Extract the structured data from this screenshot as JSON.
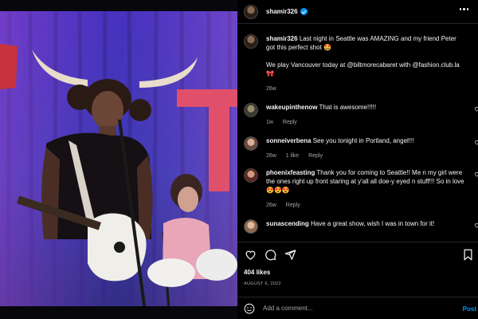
{
  "post": {
    "username": "shamir326",
    "caption_line1": "Last night in Seattle was AMAZING and my friend Peter got this perfect shot 🤩",
    "caption_line2": "We play Vancouver today at @biltmorecabaret with @fashion.club.la 🎀",
    "caption_time": "26w",
    "likes": "404 likes",
    "date": "AUGUST 6, 2022",
    "add_comment_placeholder": "Add a comment...",
    "post_label": "Post"
  },
  "comments": [
    {
      "username": "wakeupinthenow",
      "text": "That is awesome!!!!!",
      "time": "1w",
      "likes": "",
      "reply": "Reply"
    },
    {
      "username": "sonneiverbena",
      "text": "See you tonight in Portland, angel!!!",
      "time": "26w",
      "likes": "1 like",
      "reply": "Reply"
    },
    {
      "username": "phoenixfeasting",
      "text": "Thank you for coming to Seattle!! Me n my girl were the ones right up front staring at y'all all doe-y eyed n stuff!!! So in love 😍😍😍",
      "time": "26w",
      "likes": "",
      "reply": "Reply"
    },
    {
      "username": "sunascending",
      "text": "Have a great show, wish I was in town for it!",
      "time": "",
      "likes": "",
      "reply": ""
    }
  ],
  "icons": {
    "verified": "verified-badge-icon",
    "more": "more-options-icon",
    "like": "heart-icon",
    "comment": "comment-icon",
    "share": "share-icon",
    "save": "bookmark-icon",
    "emoji": "emoji-icon"
  },
  "colors": {
    "background": "#000000",
    "text": "#f5f5f5",
    "secondary_text": "#a8a8a8",
    "link_blue": "#0095f6",
    "divider": "#262626"
  }
}
